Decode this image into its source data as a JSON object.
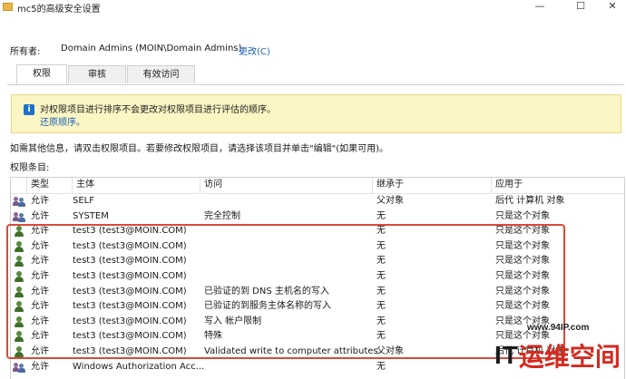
{
  "window": {
    "title": "mc5的高级安全设置",
    "minimize_glyph": "—",
    "maximize_glyph": "☐",
    "close_glyph": "✕"
  },
  "owner": {
    "label": "所有者:",
    "value": "Domain Admins (MOIN\\Domain Admins)",
    "change_label": "更改(C)"
  },
  "tabs": [
    {
      "label": "权限",
      "active": true
    },
    {
      "label": "审核",
      "active": false
    },
    {
      "label": "有效访问",
      "active": false
    }
  ],
  "info": {
    "icon": "info-icon",
    "text": "对权限项目进行排序不会更改对权限项目进行评估的顺序。",
    "link": "还原顺序。"
  },
  "hint": "如需其他信息，请双击权限项目。若要修改权限项目，请选择该项目并单击\"编辑\"(如果可用)。",
  "entries_label": "权限条目:",
  "table": {
    "columns": [
      "类型",
      "主体",
      "访问",
      "继承于",
      "应用于"
    ],
    "rows": [
      {
        "icon": "group-icon",
        "type": "允许",
        "principal": "SELF",
        "access": "",
        "inherited": "父对象",
        "applies": "后代 计算机 对象"
      },
      {
        "icon": "group-icon",
        "type": "允许",
        "principal": "SYSTEM",
        "access": "完全控制",
        "inherited": "无",
        "applies": "只是这个对象"
      },
      {
        "icon": "user-icon",
        "type": "允许",
        "principal": "test3 (test3@MOIN.COM)",
        "access": "",
        "inherited": "无",
        "applies": "只是这个对象"
      },
      {
        "icon": "user-icon",
        "type": "允许",
        "principal": "test3 (test3@MOIN.COM)",
        "access": "",
        "inherited": "无",
        "applies": "只是这个对象"
      },
      {
        "icon": "user-icon",
        "type": "允许",
        "principal": "test3 (test3@MOIN.COM)",
        "access": "",
        "inherited": "无",
        "applies": "只是这个对象"
      },
      {
        "icon": "user-icon",
        "type": "允许",
        "principal": "test3 (test3@MOIN.COM)",
        "access": "",
        "inherited": "无",
        "applies": "只是这个对象"
      },
      {
        "icon": "user-icon",
        "type": "允许",
        "principal": "test3 (test3@MOIN.COM)",
        "access": "已验证的到 DNS 主机名的写入",
        "inherited": "无",
        "applies": "只是这个对象"
      },
      {
        "icon": "user-icon",
        "type": "允许",
        "principal": "test3 (test3@MOIN.COM)",
        "access": "已验证的到服务主体名称的写入",
        "inherited": "无",
        "applies": "只是这个对象"
      },
      {
        "icon": "user-icon",
        "type": "允许",
        "principal": "test3 (test3@MOIN.COM)",
        "access": "写入 帐户限制",
        "inherited": "无",
        "applies": "只是这个对象"
      },
      {
        "icon": "user-icon",
        "type": "允许",
        "principal": "test3 (test3@MOIN.COM)",
        "access": "特殊",
        "inherited": "无",
        "applies": "只是这个对象"
      },
      {
        "icon": "user-icon",
        "type": "允许",
        "principal": "test3 (test3@MOIN.COM)",
        "access": "Validated write to computer attributes.",
        "inherited": "父对象",
        "applies": "后代 计算机 对象"
      },
      {
        "icon": "group-icon",
        "type": "允许",
        "principal": "Windows Authorization Acc...",
        "access": "",
        "inherited": "无",
        "applies": ""
      }
    ]
  },
  "watermark": {
    "url": "www.94IP.com",
    "brand_latin": "IT",
    "brand_cn": "运维空间"
  },
  "colors": {
    "info_bg": "#fcf6c4",
    "link": "#1a5fb4",
    "highlight_border": "#d94a3a",
    "watermark_red": "#d42a20"
  }
}
